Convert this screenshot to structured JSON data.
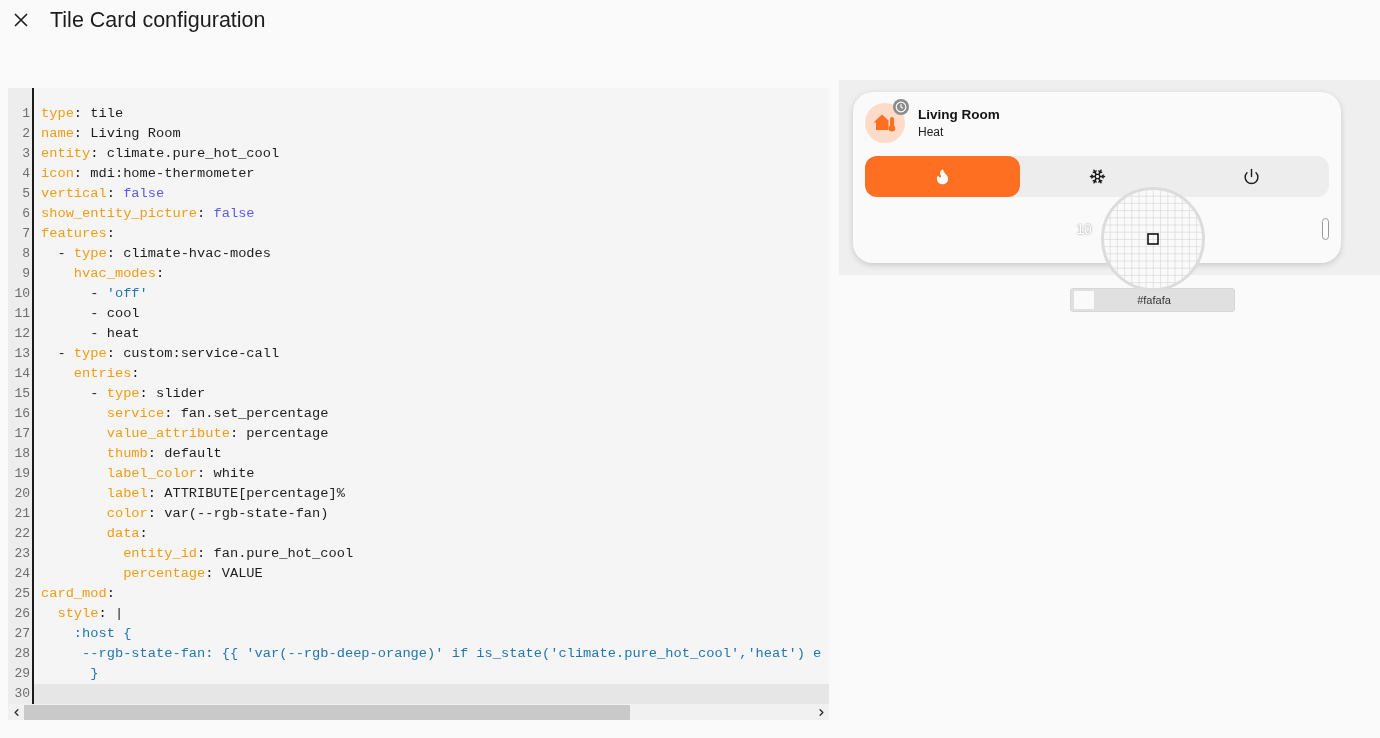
{
  "dialog": {
    "title": "Tile Card configuration"
  },
  "editor": {
    "lines": [
      {
        "number": "1",
        "active": false,
        "tokens": [
          {
            "kind": "key",
            "text": "type"
          },
          {
            "kind": "plain",
            "text": ": tile"
          }
        ]
      },
      {
        "number": "2",
        "active": false,
        "tokens": [
          {
            "kind": "key",
            "text": "name"
          },
          {
            "kind": "plain",
            "text": ": Living Room"
          }
        ]
      },
      {
        "number": "3",
        "active": false,
        "tokens": [
          {
            "kind": "key",
            "text": "entity"
          },
          {
            "kind": "plain",
            "text": ": climate.pure_hot_cool"
          }
        ]
      },
      {
        "number": "4",
        "active": false,
        "tokens": [
          {
            "kind": "key",
            "text": "icon"
          },
          {
            "kind": "plain",
            "text": ": mdi:home-thermometer"
          }
        ]
      },
      {
        "number": "5",
        "active": false,
        "tokens": [
          {
            "kind": "key",
            "text": "vertical"
          },
          {
            "kind": "plain",
            "text": ": "
          },
          {
            "kind": "bool",
            "text": "false"
          }
        ]
      },
      {
        "number": "6",
        "active": false,
        "tokens": [
          {
            "kind": "key",
            "text": "show_entity_picture"
          },
          {
            "kind": "plain",
            "text": ": "
          },
          {
            "kind": "bool",
            "text": "false"
          }
        ]
      },
      {
        "number": "7",
        "active": false,
        "tokens": [
          {
            "kind": "key",
            "text": "features"
          },
          {
            "kind": "plain",
            "text": ":"
          }
        ]
      },
      {
        "number": "8",
        "active": false,
        "tokens": [
          {
            "kind": "plain",
            "text": "  - "
          },
          {
            "kind": "key",
            "text": "type"
          },
          {
            "kind": "plain",
            "text": ": climate-hvac-modes"
          }
        ]
      },
      {
        "number": "9",
        "active": false,
        "tokens": [
          {
            "kind": "key",
            "text": "    hvac_modes"
          },
          {
            "kind": "plain",
            "text": ":"
          }
        ]
      },
      {
        "number": "10",
        "active": false,
        "tokens": [
          {
            "kind": "plain",
            "text": "      - "
          },
          {
            "kind": "string",
            "text": "'off'"
          }
        ]
      },
      {
        "number": "11",
        "active": false,
        "tokens": [
          {
            "kind": "plain",
            "text": "      - cool"
          }
        ]
      },
      {
        "number": "12",
        "active": false,
        "tokens": [
          {
            "kind": "plain",
            "text": "      - heat"
          }
        ]
      },
      {
        "number": "13",
        "active": false,
        "tokens": [
          {
            "kind": "plain",
            "text": "  - "
          },
          {
            "kind": "key",
            "text": "type"
          },
          {
            "kind": "plain",
            "text": ": custom:service-call"
          }
        ]
      },
      {
        "number": "14",
        "active": false,
        "tokens": [
          {
            "kind": "key",
            "text": "    entries"
          },
          {
            "kind": "plain",
            "text": ":"
          }
        ]
      },
      {
        "number": "15",
        "active": false,
        "tokens": [
          {
            "kind": "plain",
            "text": "      - "
          },
          {
            "kind": "key",
            "text": "type"
          },
          {
            "kind": "plain",
            "text": ": slider"
          }
        ]
      },
      {
        "number": "16",
        "active": false,
        "tokens": [
          {
            "kind": "key",
            "text": "        service"
          },
          {
            "kind": "plain",
            "text": ": fan.set_percentage"
          }
        ]
      },
      {
        "number": "17",
        "active": false,
        "tokens": [
          {
            "kind": "key",
            "text": "        value_attribute"
          },
          {
            "kind": "plain",
            "text": ": percentage"
          }
        ]
      },
      {
        "number": "18",
        "active": false,
        "tokens": [
          {
            "kind": "key",
            "text": "        thumb"
          },
          {
            "kind": "plain",
            "text": ": default"
          }
        ]
      },
      {
        "number": "19",
        "active": false,
        "tokens": [
          {
            "kind": "key",
            "text": "        label_color"
          },
          {
            "kind": "plain",
            "text": ": white"
          }
        ]
      },
      {
        "number": "20",
        "active": false,
        "tokens": [
          {
            "kind": "key",
            "text": "        label"
          },
          {
            "kind": "plain",
            "text": ": ATTRIBUTE[percentage]%"
          }
        ]
      },
      {
        "number": "21",
        "active": false,
        "tokens": [
          {
            "kind": "key",
            "text": "        color"
          },
          {
            "kind": "plain",
            "text": ": var(--rgb-state-fan)"
          }
        ]
      },
      {
        "number": "22",
        "active": false,
        "tokens": [
          {
            "kind": "key",
            "text": "        data"
          },
          {
            "kind": "plain",
            "text": ":"
          }
        ]
      },
      {
        "number": "23",
        "active": false,
        "tokens": [
          {
            "kind": "key",
            "text": "          entity_id"
          },
          {
            "kind": "plain",
            "text": ": fan.pure_hot_cool"
          }
        ]
      },
      {
        "number": "24",
        "active": false,
        "tokens": [
          {
            "kind": "key",
            "text": "          percentage"
          },
          {
            "kind": "plain",
            "text": ": VALUE"
          }
        ]
      },
      {
        "number": "25",
        "active": false,
        "tokens": [
          {
            "kind": "key",
            "text": "card_mod"
          },
          {
            "kind": "plain",
            "text": ":"
          }
        ]
      },
      {
        "number": "26",
        "active": false,
        "tokens": [
          {
            "kind": "key",
            "text": "  style"
          },
          {
            "kind": "plain",
            "text": ": |"
          }
        ]
      },
      {
        "number": "27",
        "active": false,
        "tokens": [
          {
            "kind": "string",
            "text": "    :host {"
          }
        ]
      },
      {
        "number": "28",
        "active": false,
        "tokens": [
          {
            "kind": "string",
            "text": "     --rgb-state-fan: {{ 'var(--rgb-deep-orange)' if is_state('climate.pure_hot_cool','heat') e"
          }
        ]
      },
      {
        "number": "29",
        "active": false,
        "tokens": [
          {
            "kind": "string",
            "text": "      }"
          }
        ]
      },
      {
        "number": "30",
        "active": true
      }
    ]
  },
  "preview": {
    "card": {
      "name": "Living Room",
      "state": "Heat",
      "hvac_modes": [
        {
          "kind": "heat",
          "selected": true
        },
        {
          "kind": "cool",
          "selected": false
        },
        {
          "kind": "off",
          "selected": false
        }
      ],
      "slider": {
        "label": "10",
        "level": 1
      }
    },
    "color_picker": {
      "value": "#fafafa"
    }
  }
}
